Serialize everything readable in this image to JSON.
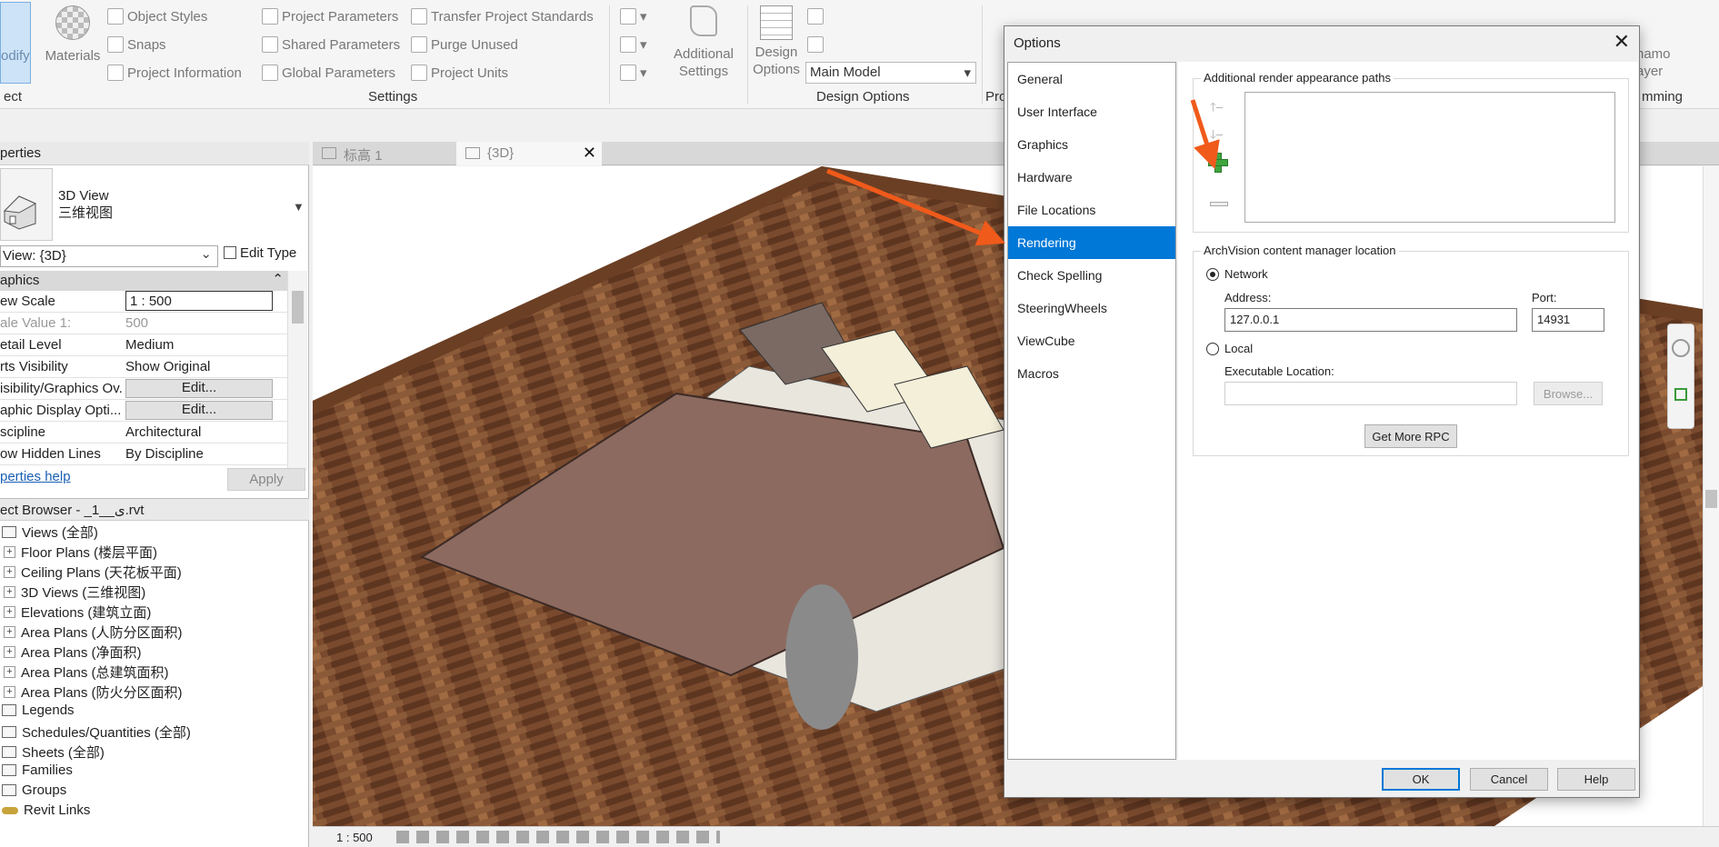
{
  "ribbon": {
    "modify_label": "odify",
    "materials_label": "Materials",
    "object_styles": "Object  Styles",
    "snaps": "Snaps",
    "project_information": "Project  Information",
    "project_parameters": "Project  Parameters",
    "shared_parameters": "Shared  Parameters",
    "global_parameters": "Global  Parameters",
    "transfer_standards": "Transfer  Project Standards",
    "purge_unused": "Purge  Unused",
    "project_units": "Project  Units",
    "additional_settings_1": "Additional",
    "additional_settings_2": "Settings",
    "design_options_1": "Design",
    "design_options_2": "Options",
    "design_combo_value": "Main Model",
    "panel_project": "ect",
    "panel_settings": "Settings",
    "panel_design_options": "Design Options",
    "panel_pro": "Pro",
    "panel_programming": "mming",
    "dynamo_1": "namo",
    "dynamo_2": "ayer"
  },
  "properties": {
    "title": "perties",
    "type_line1": "3D View",
    "type_line2": "三维视图",
    "view_combo": "View: {3D}",
    "edit_type": "Edit Type",
    "group_graphics": "aphics",
    "rows": [
      {
        "key": "ew Scale",
        "value": "1 : 500"
      },
      {
        "key": "ale Value    1:",
        "value": "500"
      },
      {
        "key": "etail Level",
        "value": "Medium"
      },
      {
        "key": "rts Visibility",
        "value": "Show Original"
      },
      {
        "key": "isibility/Graphics Ov...",
        "value": "Edit..."
      },
      {
        "key": "aphic Display Opti...",
        "value": "Edit..."
      },
      {
        "key": "scipline",
        "value": "Architectural"
      },
      {
        "key": "ow Hidden Lines",
        "value": "By Discipline"
      }
    ],
    "help_link": "perties help",
    "apply": "Apply"
  },
  "browser": {
    "title": "ect Browser - _1__ى.rvt",
    "items": [
      {
        "label": "Views (全部)"
      },
      {
        "label": "Floor Plans (楼层平面)"
      },
      {
        "label": "Ceiling Plans (天花板平面)"
      },
      {
        "label": "3D Views (三维视图)"
      },
      {
        "label": "Elevations (建筑立面)"
      },
      {
        "label": "Area Plans (人防分区面积)"
      },
      {
        "label": "Area Plans (净面积)"
      },
      {
        "label": "Area Plans (总建筑面积)"
      },
      {
        "label": "Area Plans (防火分区面积)"
      },
      {
        "label": "Legends"
      },
      {
        "label": "Schedules/Quantities (全部)"
      },
      {
        "label": "Sheets (全部)"
      },
      {
        "label": "Families"
      },
      {
        "label": "Groups"
      },
      {
        "label": "Revit Links"
      }
    ]
  },
  "view_tabs": [
    {
      "label": "标高 1"
    },
    {
      "label": "{3D}"
    }
  ],
  "viewbar": {
    "scale": "1 : 500"
  },
  "dialog": {
    "title": "Options",
    "nav": [
      {
        "label": "General"
      },
      {
        "label": "User Interface"
      },
      {
        "label": "Graphics"
      },
      {
        "label": "Hardware"
      },
      {
        "label": "File Locations"
      },
      {
        "label": "Rendering"
      },
      {
        "label": "Check Spelling"
      },
      {
        "label": "SteeringWheels"
      },
      {
        "label": "ViewCube"
      },
      {
        "label": "Macros"
      }
    ],
    "selected_nav": "Rendering",
    "render_paths_title": "Additional render appearance paths",
    "archvision_title": "ArchVision content manager location",
    "network_label": "Network",
    "address_label": "Address:",
    "address_value": "127.0.0.1",
    "port_label": "Port:",
    "port_value": "14931",
    "local_label": "Local",
    "exec_label": "Executable Location:",
    "exec_value": "",
    "browse": "Browse...",
    "get_more_rpc": "Get More RPC",
    "ok": "OK",
    "cancel": "Cancel",
    "help": "Help"
  },
  "colors": {
    "selection": "#0078d7",
    "arrow": "#f05a1a",
    "add_icon": "#3fa53f",
    "floor_wood": "#7a4a2e",
    "bed_cover": "#8c6a60"
  }
}
